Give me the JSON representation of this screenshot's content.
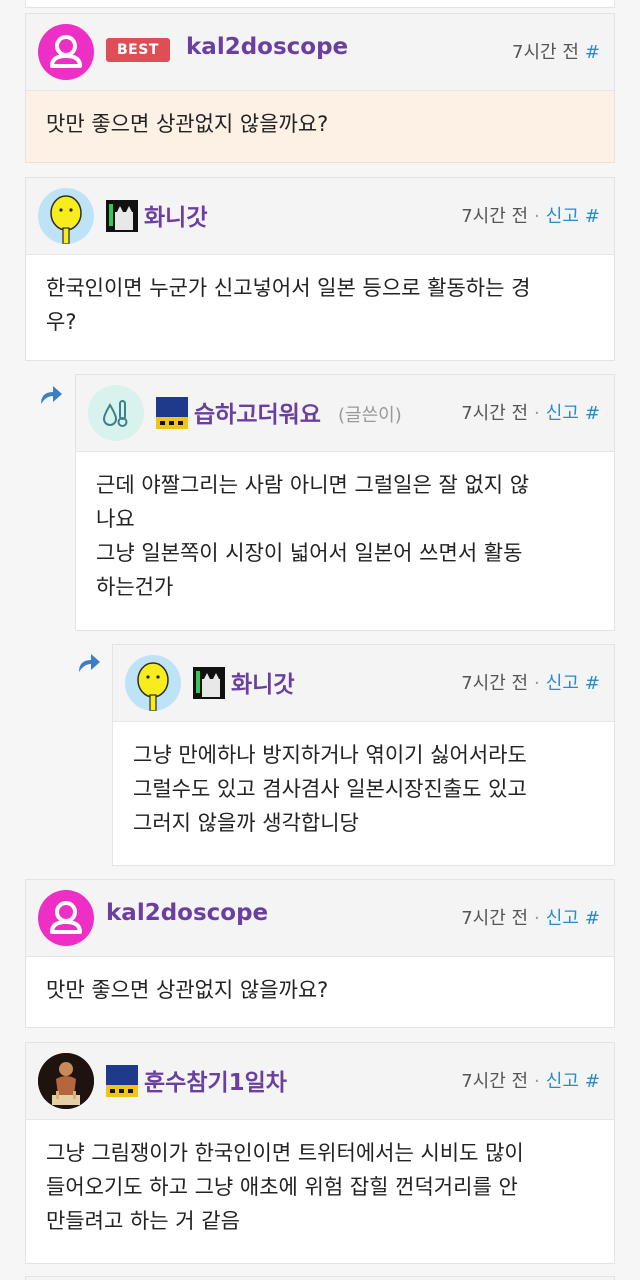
{
  "comments": [
    {
      "best_badge": "BEST",
      "nick": "kal2doscope",
      "time": "7시간 전",
      "hash": "#",
      "lines": [
        "맛만 좋으면 상관없지 않을까요?"
      ]
    },
    {
      "nick": "화니갓",
      "time": "7시간 전",
      "report": "신고",
      "hash": "#",
      "lines": [
        "한국인이면 누군가 신고넣어서 일본 등으로 활동하는 경",
        "우?"
      ]
    },
    {
      "nick": "습하고더워요",
      "writer_tag": "(글쓴이)",
      "time": "7시간 전",
      "report": "신고",
      "hash": "#",
      "lines": [
        "근데 야짤그리는 사람 아니면 그럴일은 잘 없지 않",
        "나요",
        "그냥 일본쪽이 시장이 넓어서 일본어 쓰면서 활동",
        "하는건가"
      ]
    },
    {
      "nick": "화니갓",
      "time": "7시간 전",
      "report": "신고",
      "hash": "#",
      "lines": [
        "그냥 만에하나 방지하거나 엮이기 싫어서라도",
        "그럴수도 있고 겸사겸사 일본시장진출도 있고",
        "그러지 않을까 생각합니당"
      ]
    },
    {
      "nick": "kal2doscope",
      "time": "7시간 전",
      "report": "신고",
      "hash": "#",
      "lines": [
        "맛만 좋으면 상관없지 않을까요?"
      ]
    },
    {
      "nick": "훈수참기1일차",
      "time": "7시간 전",
      "report": "신고",
      "hash": "#",
      "lines": [
        "그냥 그림쟁이가 한국인이면 트위터에서는 시비도 많이",
        "들어오기도 하고 그냥 애초에 위험 잡힐 껀덕거리를 안",
        "만들려고 하는 거 같음"
      ]
    }
  ],
  "colors": {
    "nick": "#6a3fa0",
    "best_badge": "#e04e55",
    "best_body": "#fdf1e6",
    "link": "#2a8bc9"
  }
}
